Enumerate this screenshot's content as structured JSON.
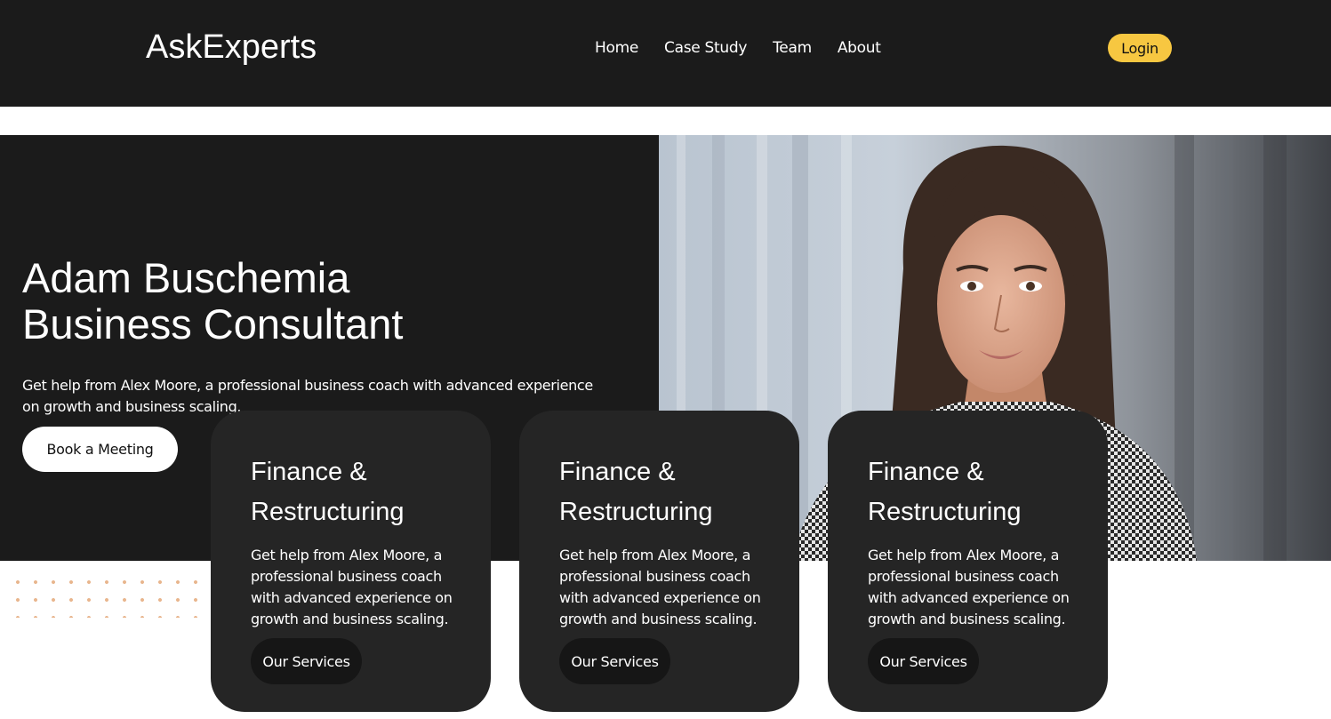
{
  "header": {
    "brand": "AskExperts",
    "nav": [
      "Home",
      "Case Study",
      "Team",
      "About"
    ],
    "login_label": "Login",
    "accent_color": "#f7c741"
  },
  "hero": {
    "title_line1": "Adam Buschemia",
    "title_line2": "Business Consultant",
    "description": "Get help from Alex Moore, a professional business coach with advanced experience on growth and business scaling.",
    "cta_label": "Book a Meeting"
  },
  "cards": [
    {
      "title": "Finance & Restructuring",
      "description": "Get help from Alex Moore, a professional business coach with advanced experience on growth and business scaling.",
      "button_label": "Our Services"
    },
    {
      "title": "Finance & Restructuring",
      "description": "Get help from Alex Moore, a professional business coach with advanced experience on growth and business scaling.",
      "button_label": "Our Services"
    },
    {
      "title": "Finance & Restructuring",
      "description": "Get help from Alex Moore, a professional business coach with advanced experience on growth and business scaling.",
      "button_label": "Our Services"
    }
  ]
}
